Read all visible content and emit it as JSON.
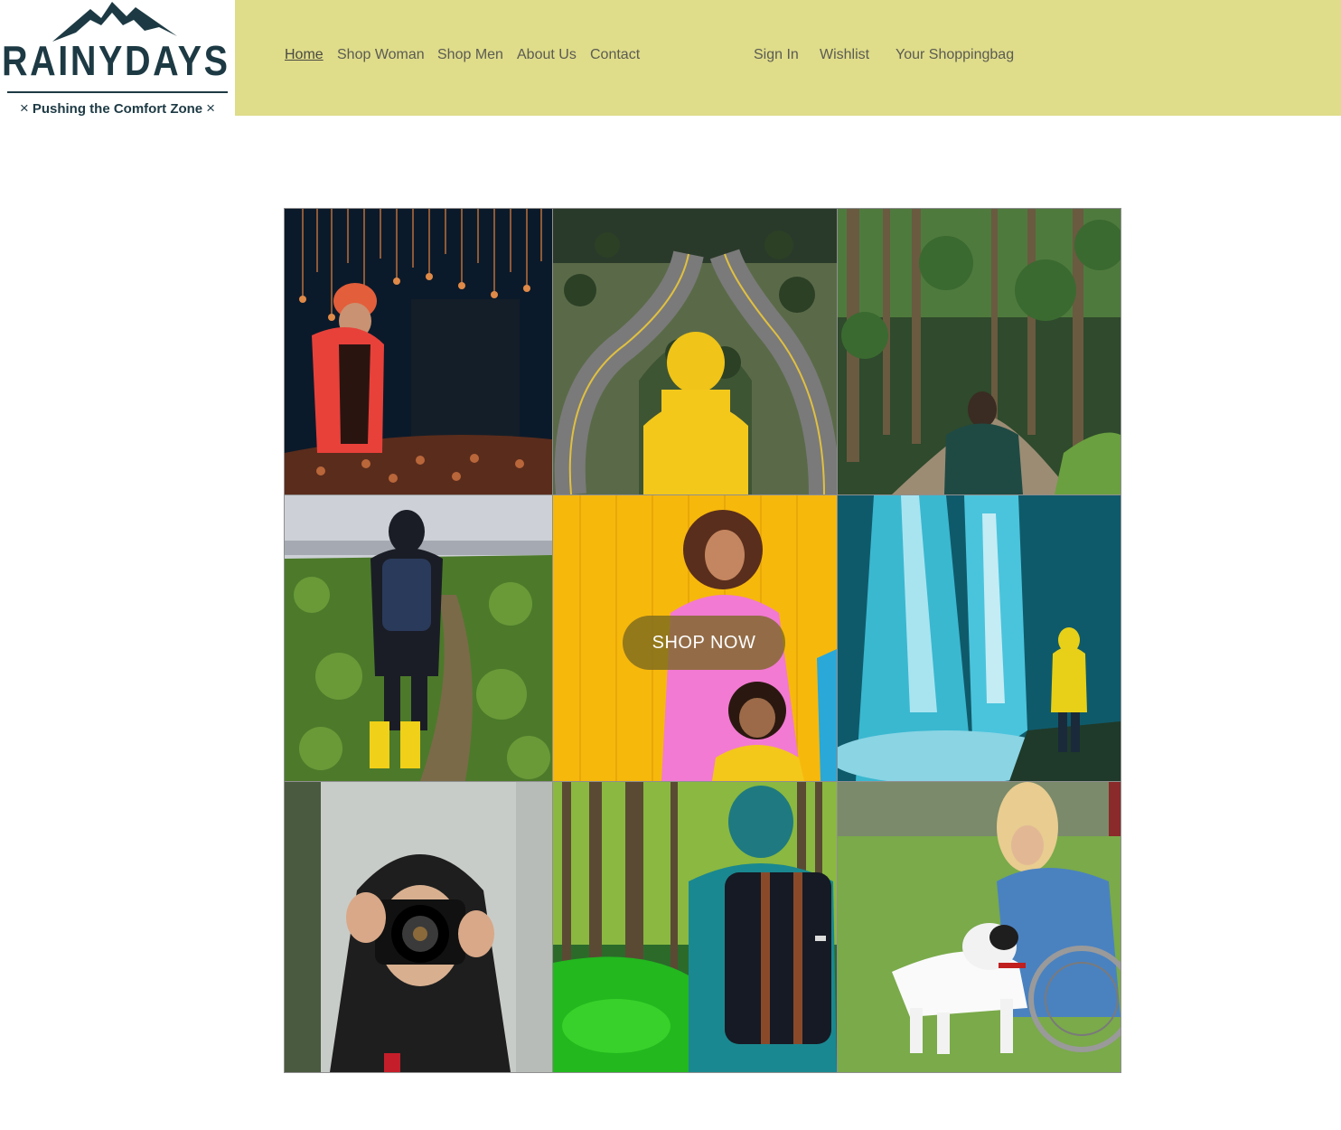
{
  "logo": {
    "wordmark": "RAINYDAYS",
    "tagline": "Pushing the Comfort Zone",
    "tagline_mark": "×"
  },
  "nav": {
    "items": [
      {
        "label": "Home",
        "active": true
      },
      {
        "label": "Shop Woman",
        "active": false
      },
      {
        "label": "Shop Men",
        "active": false
      },
      {
        "label": "About Us",
        "active": false
      },
      {
        "label": "Contact",
        "active": false
      }
    ],
    "account": [
      {
        "label": "Sign In"
      },
      {
        "label": "Wishlist"
      },
      {
        "label": "Your Shoppingbag"
      }
    ]
  },
  "hero": {
    "cta_label": "SHOP NOW"
  },
  "colors": {
    "header_bg": "#dfdc8a",
    "brand_dark": "#1d3a44",
    "nav_text": "#5b5b52",
    "cta_bg": "#786820"
  }
}
